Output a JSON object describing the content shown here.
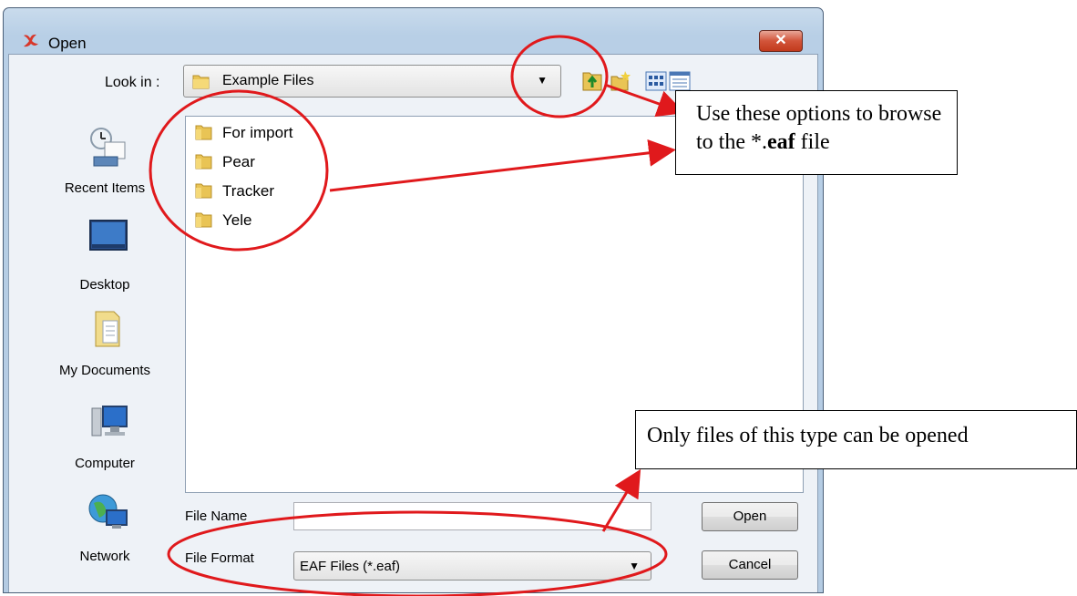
{
  "window": {
    "title": "Open",
    "close_label": "✕"
  },
  "toolbar": {
    "look_in_label": "Look in :",
    "look_in_value": "Example Files",
    "buttons": [
      "up-one-level",
      "create-new-folder",
      "list-view",
      "details-view"
    ]
  },
  "places": [
    {
      "label": "Recent Items",
      "icon": "recent-items-icon"
    },
    {
      "label": "Desktop",
      "icon": "desktop-icon"
    },
    {
      "label": "My Documents",
      "icon": "my-documents-icon"
    },
    {
      "label": "Computer",
      "icon": "computer-icon"
    },
    {
      "label": "Network",
      "icon": "network-icon"
    }
  ],
  "files": [
    {
      "name": "For import"
    },
    {
      "name": "Pear"
    },
    {
      "name": "Tracker"
    },
    {
      "name": "Yele"
    }
  ],
  "form": {
    "file_name_label": "File Name",
    "file_name_value": "",
    "file_format_label": "File Format",
    "file_format_value": "EAF Files (*.eaf)"
  },
  "buttons": {
    "open": "Open",
    "cancel": "Cancel"
  },
  "annotations": {
    "browse_line1": "Use these options to browse",
    "browse_line2_prefix": "to the *.",
    "browse_line2_bold": "eaf",
    "browse_line2_suffix": " file",
    "type_note": "Only files of this type can be opened"
  },
  "colors": {
    "annotation_red": "#e0191c",
    "title_gradient_top": "#c9dbec",
    "close_button": "#c23a1c",
    "folder_yellow": "#e9c455"
  }
}
